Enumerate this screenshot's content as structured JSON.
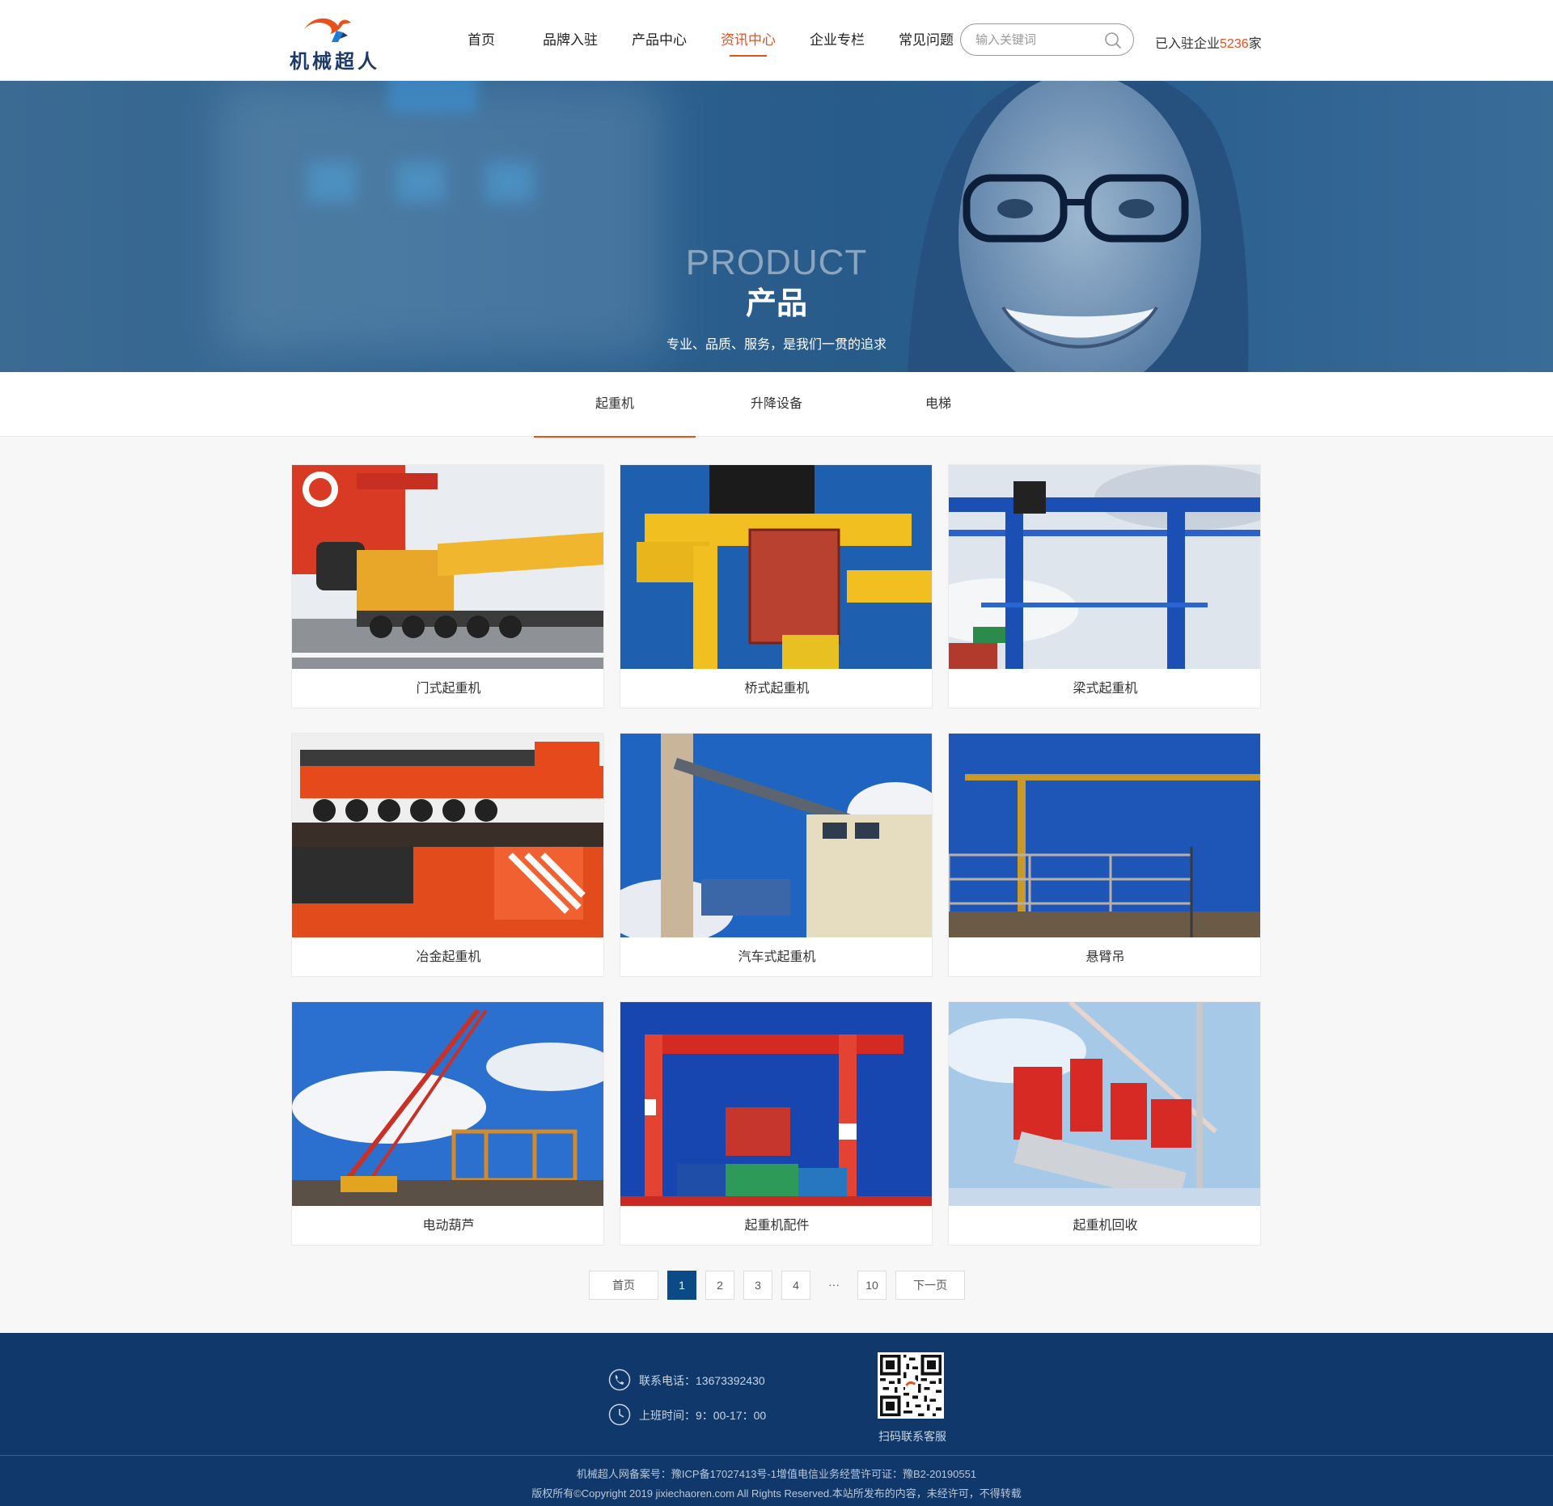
{
  "header": {
    "logo_text": "机械超人",
    "nav": [
      "首页",
      "品牌入驻",
      "产品中心",
      "资讯中心",
      "企业专栏",
      "常见问题"
    ],
    "active_nav": "资讯中心",
    "search_placeholder": "输入关键词",
    "joined_prefix": "已入驻企业",
    "joined_count": "5236",
    "joined_suffix": "家"
  },
  "banner": {
    "en": "PRODUCT",
    "cn": "产品",
    "subtitle": "专业、品质、服务，是我们一贯的追求"
  },
  "tabs": {
    "items": [
      "起重机",
      "升降设备",
      "电梯"
    ],
    "active": "起重机"
  },
  "products": [
    {
      "name": "门式起重机",
      "image": "mobile-crane-truck"
    },
    {
      "name": "桥式起重机",
      "image": "container-crane"
    },
    {
      "name": "梁式起重机",
      "image": "blue-gantry-crane"
    },
    {
      "name": "冶金起重机",
      "image": "orange-heavy-crane"
    },
    {
      "name": "汽车式起重机",
      "image": "ship-container-crane"
    },
    {
      "name": "悬臂吊",
      "image": "tower-crane"
    },
    {
      "name": "电动葫芦",
      "image": "crawler-crane"
    },
    {
      "name": "起重机配件",
      "image": "red-gantry-crane"
    },
    {
      "name": "起重机回收",
      "image": "lego-movie-crane"
    }
  ],
  "pagination": {
    "first": "首页",
    "pages": [
      "1",
      "2",
      "3",
      "4"
    ],
    "ellipsis": "···",
    "last_page": "10",
    "next": "下一页",
    "current": "1"
  },
  "footer": {
    "phone_label": "联系电话：13673392430",
    "hours_label": "上班时间：9：00-17：00",
    "qr_label": "扫码联系客服",
    "icp": "机械超人网备案号：豫ICP备17027413号-1增值电信业务经营许可证：豫B2-20190551",
    "copyright": "版权所有©Copyright 2019 jixiechaoren.com All Rights Reserved.本站所发布的内容，未经许可，不得转载"
  },
  "colors": {
    "accent": "#e8501e",
    "footer_bg": "#10386a",
    "active_page": "#0b4a86"
  }
}
